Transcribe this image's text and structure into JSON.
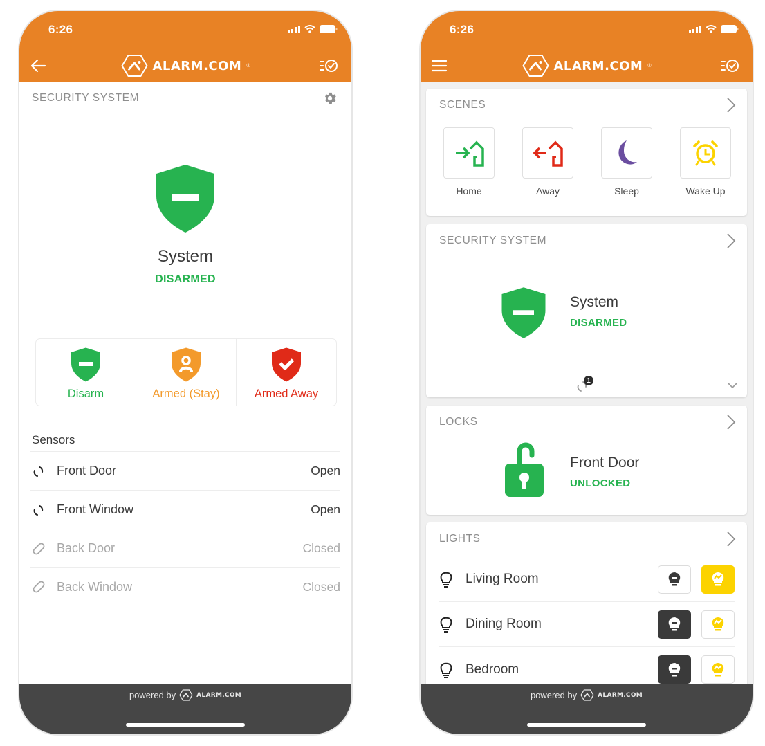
{
  "colors": {
    "brand_orange": "#e88225",
    "green": "#27b350",
    "orange": "#f39a2b",
    "red": "#e02a18",
    "purple": "#6b4ea0",
    "yellow": "#fcd300",
    "footer_gray": "#464646"
  },
  "left": {
    "status_bar": {
      "time": "6:26"
    },
    "nav": {
      "back_icon": "arrow-left-icon",
      "brand": "ALARM.COM",
      "right_icon": "list-check-icon"
    },
    "header": {
      "title": "SECURITY SYSTEM",
      "settings_icon": "gear-icon"
    },
    "system": {
      "name": "System",
      "state": "DISARMED",
      "icon": "shield-disarmed-icon"
    },
    "arm_options": [
      {
        "label": "Disarm",
        "icon": "shield-minus-icon",
        "color": "#27b350"
      },
      {
        "label": "Armed (Stay)",
        "icon": "shield-person-icon",
        "color": "#f39a2b"
      },
      {
        "label": "Armed Away",
        "icon": "shield-check-icon",
        "color": "#e02a18"
      }
    ],
    "sensors": {
      "title": "Sensors",
      "items": [
        {
          "name": "Front Door",
          "status": "Open",
          "state": "open"
        },
        {
          "name": "Front Window",
          "status": "Open",
          "state": "open"
        },
        {
          "name": "Back Door",
          "status": "Closed",
          "state": "closed"
        },
        {
          "name": "Back Window",
          "status": "Closed",
          "state": "closed"
        }
      ]
    },
    "footer": {
      "powered_by": "powered by",
      "brand": "ALARM.COM"
    }
  },
  "right": {
    "status_bar": {
      "time": "6:26"
    },
    "nav": {
      "menu_icon": "hamburger-menu-icon",
      "brand": "ALARM.COM",
      "right_icon": "list-check-icon"
    },
    "scenes": {
      "title": "SCENES",
      "items": [
        {
          "label": "Home",
          "icon": "home-arrive-icon"
        },
        {
          "label": "Away",
          "icon": "home-leave-icon"
        },
        {
          "label": "Sleep",
          "icon": "moon-icon"
        },
        {
          "label": "Wake Up",
          "icon": "alarm-clock-icon"
        }
      ]
    },
    "security": {
      "title": "SECURITY SYSTEM",
      "name": "System",
      "state": "DISARMED",
      "open_sensor_count": "1"
    },
    "locks": {
      "title": "LOCKS",
      "name": "Front Door",
      "state": "UNLOCKED"
    },
    "lights": {
      "title": "LIGHTS",
      "items": [
        {
          "name": "Living Room",
          "state": "on"
        },
        {
          "name": "Dining Room",
          "state": "off"
        },
        {
          "name": "Bedroom",
          "state": "off"
        }
      ]
    },
    "footer": {
      "powered_by": "powered by",
      "brand": "ALARM.COM"
    }
  }
}
